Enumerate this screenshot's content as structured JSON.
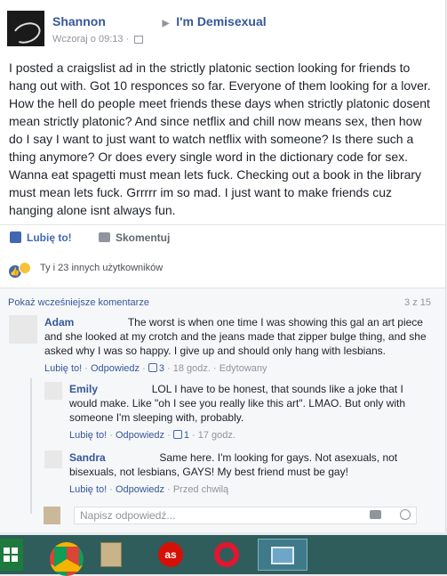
{
  "post": {
    "author": "Shannon",
    "group": "I'm Demisexual",
    "timestamp": "Wczoraj o 09:13",
    "body": "I posted a craigslist ad in the strictly platonic section looking for friends to hang out with. Got 10 responces so far. Everyone of them looking for a lover. How the hell do people meet friends these days when strictly platonic dosent mean strictly platonic? And since netflix and chill now means sex, then how do I say I want to just want to watch netflix with someone? Is there such a thing anymore? Or does every single word in the dictionary code for sex. Wanna eat spagetti must mean lets fuck. Checking out a book in the library must mean lets fuck. Grrrrr im so mad. I just want to make friends cuz hanging alone isnt always fun."
  },
  "actions": {
    "like_label": "Lubię to!",
    "comment_label": "Skomentuj"
  },
  "reactions": {
    "text": "Ty i 23 innych użytkowników"
  },
  "comments_section": {
    "previous_label": "Pokaż wcześniejsze komentarze",
    "count": "3 z 15",
    "comments": [
      {
        "name": "Adam",
        "text": "The worst is when one time I was showing this gal an art piece and she looked at my crotch and the jeans made that zipper bulge thing, and she asked why I was so happy. I give up and should only hang with lesbians.",
        "like": "Lubię to!",
        "reply": "Odpowiedz",
        "likes": "3",
        "time": "18 godz.",
        "edited": "Edytowany"
      }
    ],
    "replies": [
      {
        "name": "Emily",
        "text": "LOL I have to be honest, that sounds like a joke that I would make. Like \"oh I see you really like this art\". LMAO. But only with someone I'm sleeping with, probably.",
        "like": "Lubię to!",
        "reply": "Odpowiedz",
        "likes": "1",
        "time": "17 godz."
      },
      {
        "name": "Sandra",
        "text": "Same here. I'm looking for gays. Not asexuals, not bisexuals, not lesbians, GAYS! My best friend must be gay!",
        "like": "Lubię to!",
        "reply": "Odpowiedz",
        "time": "Przed chwilą"
      }
    ],
    "reply_placeholder": "Napisz odpowiedź..."
  },
  "taskbar": {
    "lastfm_label": "as",
    "icons": [
      "windows-start-icon",
      "chrome-like-icon",
      "folder-app-icon",
      "lastfm-icon",
      "opera-icon",
      "photos-icon"
    ]
  }
}
